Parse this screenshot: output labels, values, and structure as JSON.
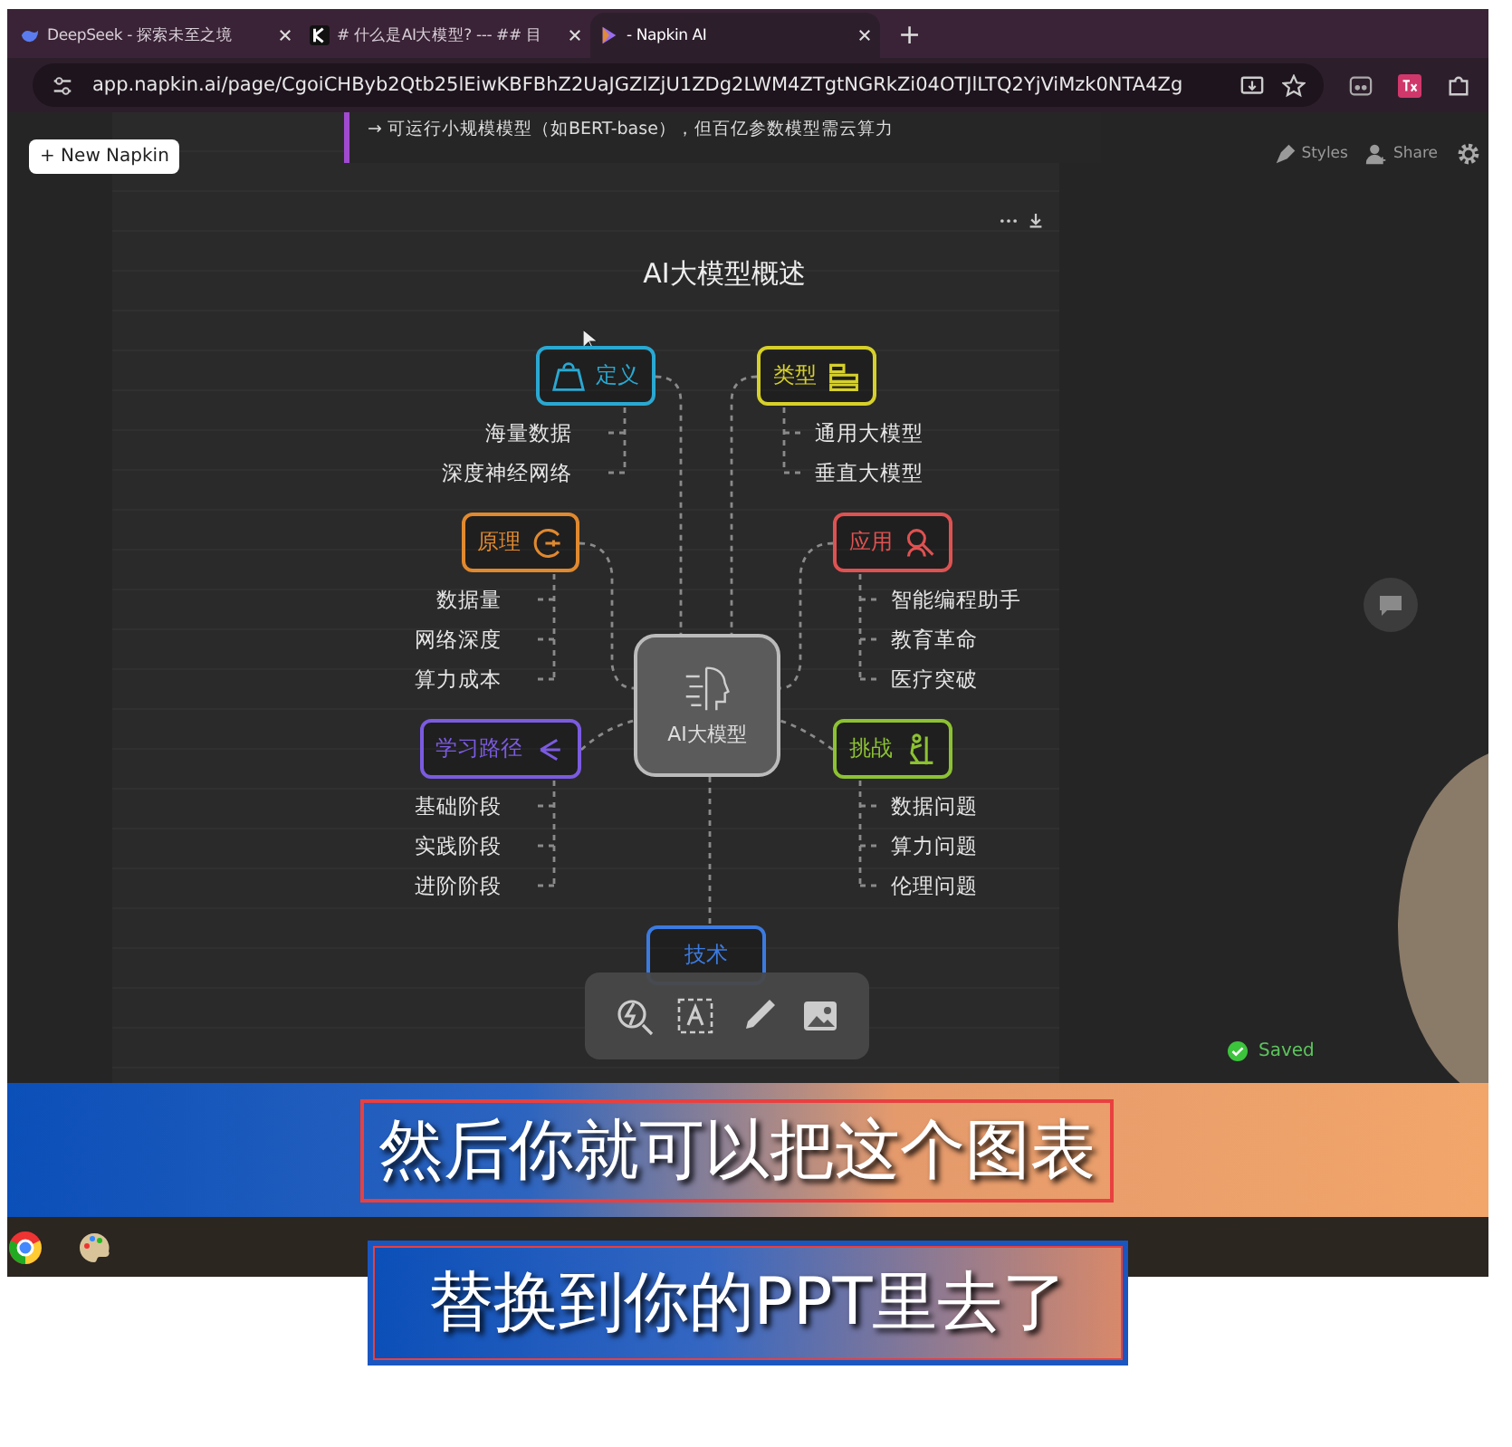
{
  "browser": {
    "tabs": [
      {
        "title": "DeepSeek - 探索未至之境",
        "selected": false
      },
      {
        "title": "# 什么是AI大模型? --- ## 目",
        "selected": false
      },
      {
        "title": "- Napkin AI",
        "selected": true
      }
    ],
    "new_tab": "+",
    "url": "app.napkin.ai/page/CgoiCHByb2Qtb25lEiwKBFBhZ2UaJGZlZjU1ZDg2LWM4ZTgtNGRkZi04OTJlLTQ2YjViMzk0NTA4Zg"
  },
  "app": {
    "new_button": "+ New Napkin",
    "doc_line": "→ 可运行小规模模型（如BERT-base），但百亿参数模型需云算力",
    "styles": "Styles",
    "share": "Share",
    "status": "Saved"
  },
  "diagram": {
    "title": "AI大模型概述",
    "center": "AI大模型",
    "branches": [
      {
        "label": "定义",
        "color": "#2aa8d2",
        "children": [
          "海量数据",
          "深度神经网络"
        ]
      },
      {
        "label": "类型",
        "color": "#d6d02a",
        "children": [
          "通用大模型",
          "垂直大模型"
        ]
      },
      {
        "label": "原理",
        "color": "#e0892f",
        "children": [
          "数据量",
          "网络深度",
          "算力成本"
        ]
      },
      {
        "label": "应用",
        "color": "#df5252",
        "children": [
          "智能编程助手",
          "教育革命",
          "医疗突破"
        ]
      },
      {
        "label": "学习路径",
        "color": "#7b5be0",
        "children": [
          "基础阶段",
          "实践阶段",
          "进阶阶段"
        ]
      },
      {
        "label": "挑战",
        "color": "#8cc232",
        "children": [
          "数据问题",
          "算力问题",
          "伦理问题"
        ]
      },
      {
        "label": "技术",
        "color": "#3b7be0"
      }
    ]
  },
  "subtitles": [
    "然后你就可以把这个图表",
    "替换到你的PPT里去了"
  ]
}
